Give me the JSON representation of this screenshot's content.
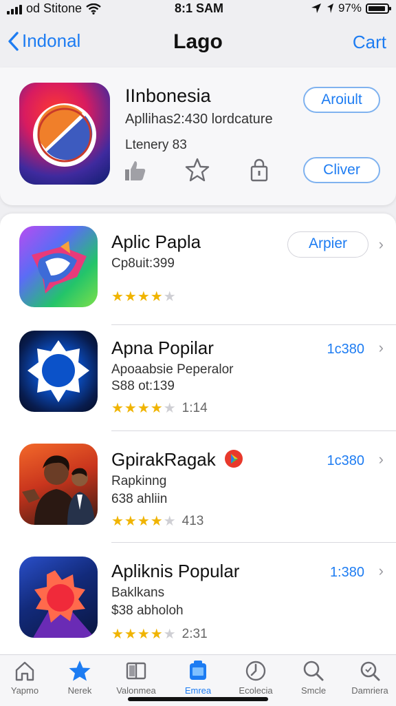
{
  "status_bar": {
    "carrier": "od Stitone",
    "time": "8:1 SAM",
    "battery": "97%"
  },
  "nav": {
    "back_label": "Indonal",
    "title": "Lago",
    "right_label": "Cart"
  },
  "featured": {
    "name": "IInbonesia",
    "subtitle": "Apllihas2:430 lordcature",
    "rank": "Ltenery 83",
    "about_label": "Aroiult",
    "action_label": "Cliver",
    "action_icons": [
      "thumbs-up-icon",
      "star-icon",
      "lock-icon"
    ]
  },
  "apps": [
    {
      "name": "Aplic Papla",
      "line1": "Cp8uit:399",
      "line2": "",
      "stars": 4,
      "rating_count": "",
      "button_label": "Arpier",
      "price": "",
      "badge": false
    },
    {
      "name": "Apna Popilar",
      "line1": "Apoaabsie Peperalor",
      "line2": "S88 ot:139",
      "stars": 4,
      "rating_count": "1:14",
      "button_label": "",
      "price": "1c380",
      "badge": false
    },
    {
      "name": "GpirakRagak",
      "line1": "Rapkinng",
      "line2": "638 ahliin",
      "stars": 4,
      "rating_count": "413",
      "button_label": "",
      "price": "1c380",
      "badge": true
    },
    {
      "name": "Apliknis Popular",
      "line1": "Baklkans",
      "line2": "$38 abholoh",
      "stars": 4,
      "rating_count": "2:31",
      "button_label": "",
      "price": "1:380",
      "badge": false
    }
  ],
  "tabs": [
    {
      "label": "Yapmo",
      "icon": "home-icon",
      "active": false
    },
    {
      "label": "Nerek",
      "icon": "star-icon",
      "active": false
    },
    {
      "label": "Valonmea",
      "icon": "book-icon",
      "active": false
    },
    {
      "label": "Emrea",
      "icon": "gift-icon",
      "active": true
    },
    {
      "label": "Ecolecia",
      "icon": "clock-icon",
      "active": false
    },
    {
      "label": "Smcle",
      "icon": "search-icon",
      "active": false
    },
    {
      "label": "Damriera",
      "icon": "search-alt-icon",
      "active": false
    }
  ],
  "colors": {
    "accent": "#1d7cf2",
    "star": "#f0b400"
  }
}
